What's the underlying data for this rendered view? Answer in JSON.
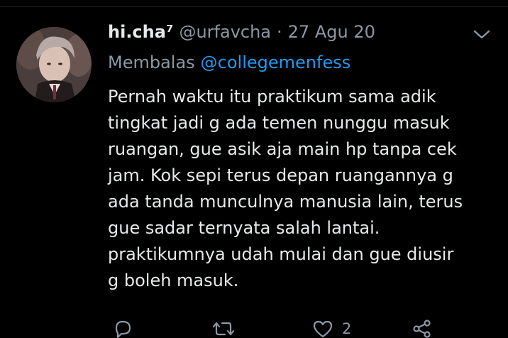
{
  "tweet": {
    "display_name": "hi.cha⁷",
    "handle": "@urfavcha",
    "separator": "·",
    "date": "27 Agu 20",
    "reply_prefix": "Membalas",
    "reply_to": "@collegemenfess",
    "lines": [
      "Pernah waktu itu praktikum sama adik",
      "tingkat jadi g ada temen nunggu masuk",
      "ruangan, gue asik aja main hp tanpa cek",
      "jam. Kok sepi terus depan ruangannya g",
      "ada tanda munculnya manusia lain, terus",
      "gue sadar ternyata salah lantai.",
      "praktikumnya udah mulai dan gue diusir",
      "g boleh masuk."
    ]
  },
  "actions": {
    "reply_icon": "reply-icon",
    "retweet_icon": "retweet-icon",
    "like_icon": "heart-icon",
    "like_count": "2",
    "share_icon": "share-icon"
  },
  "colors": {
    "background": "#000000",
    "text": "#e7e9ea",
    "secondary": "#8b98a5",
    "link": "#1d9bf0"
  }
}
